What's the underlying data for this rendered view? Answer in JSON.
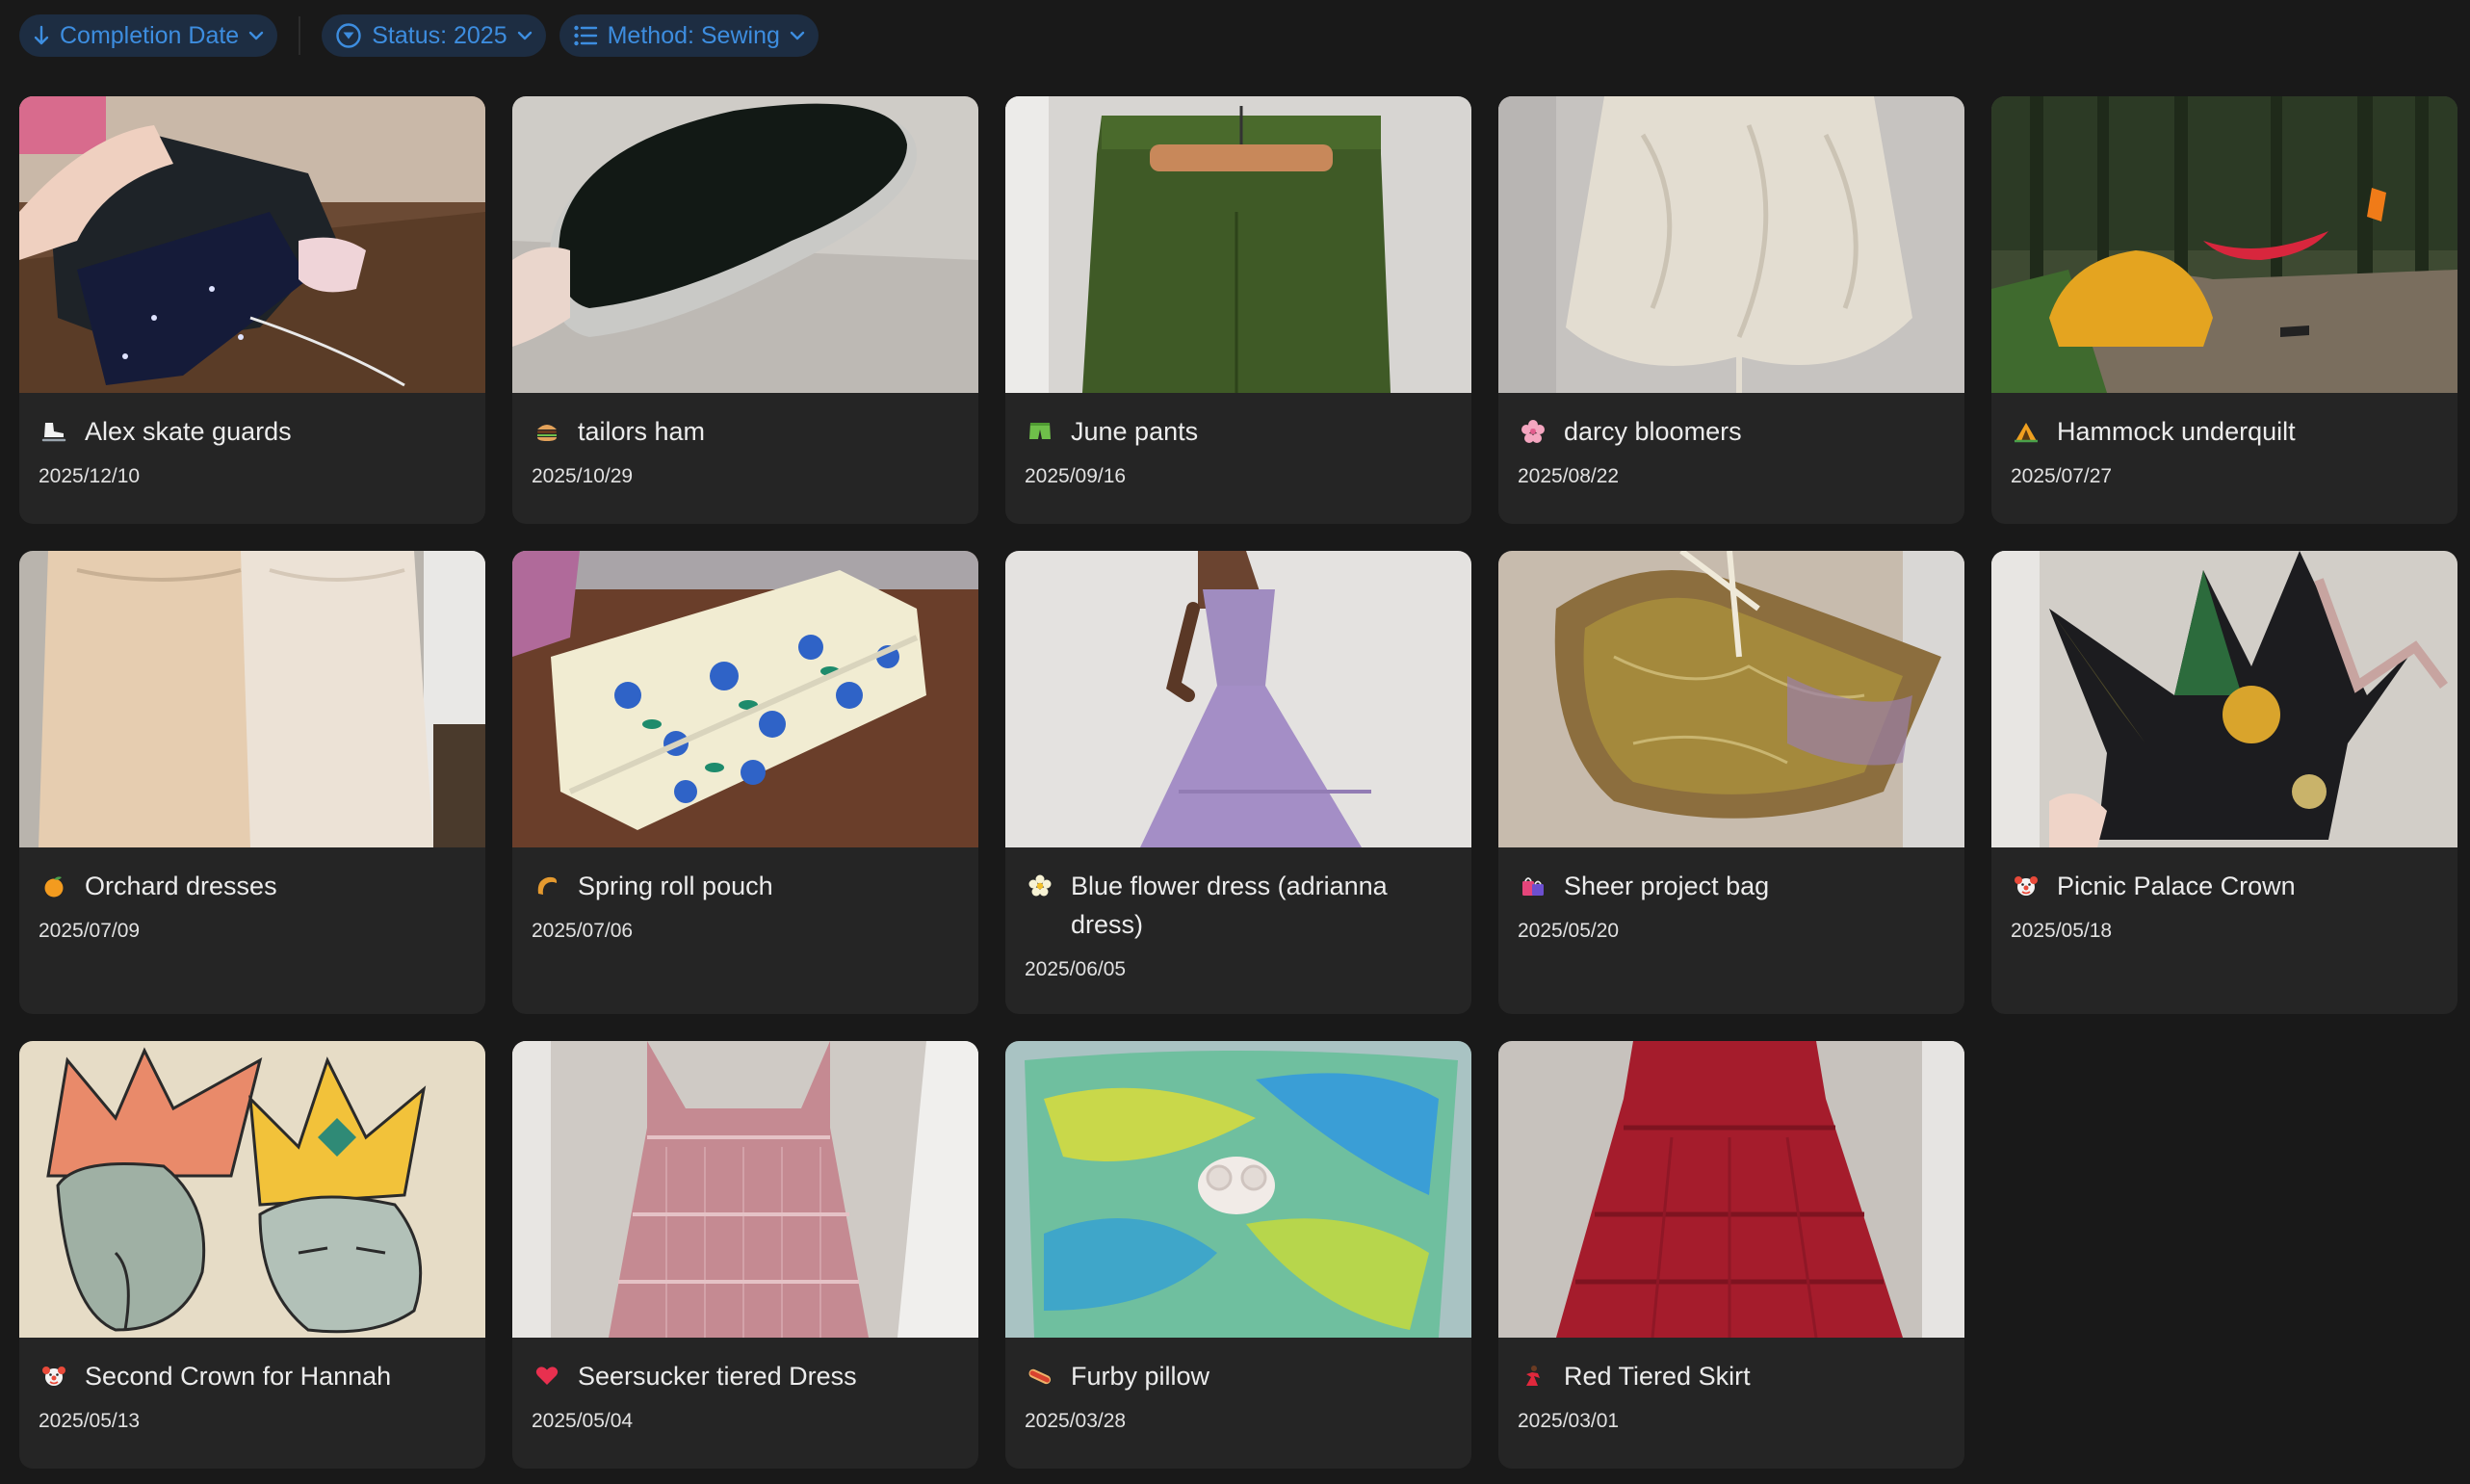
{
  "toolbar": {
    "sort_label": "Completion Date",
    "status_label": "Status: 2025",
    "method_label": "Method: Sewing",
    "accent": "#3d8ddf"
  },
  "cards": [
    {
      "title": "Alex skate guards",
      "date": "2025/12/10",
      "icon": "ice-skate-icon"
    },
    {
      "title": "tailors ham",
      "date": "2025/10/29",
      "icon": "hamburger-icon"
    },
    {
      "title": "June pants",
      "date": "2025/09/16",
      "icon": "shorts-icon"
    },
    {
      "title": "darcy bloomers",
      "date": "2025/08/22",
      "icon": "cherry-blossom-icon"
    },
    {
      "title": "Hammock underquilt",
      "date": "2025/07/27",
      "icon": "camping-icon"
    },
    {
      "title": "Orchard dresses",
      "date": "2025/07/09",
      "icon": "orange-icon"
    },
    {
      "title": "Spring roll pouch",
      "date": "2025/07/06",
      "icon": "spring-roll-icon"
    },
    {
      "title": "Blue flower dress (adrianna dress)",
      "date": "2025/06/05",
      "icon": "blossom-icon"
    },
    {
      "title": "Sheer project bag",
      "date": "2025/05/20",
      "icon": "shopping-bags-icon"
    },
    {
      "title": "Picnic Palace Crown",
      "date": "2025/05/18",
      "icon": "clown-face-icon"
    },
    {
      "title": "Second Crown for Hannah",
      "date": "2025/05/13",
      "icon": "clown-face-icon"
    },
    {
      "title": "Seersucker tiered Dress",
      "date": "2025/05/04",
      "icon": "heart-icon"
    },
    {
      "title": "Furby pillow",
      "date": "2025/03/28",
      "icon": "hotdog-icon"
    },
    {
      "title": "Red Tiered Skirt",
      "date": "2025/03/01",
      "icon": "dancer-icon"
    }
  ]
}
